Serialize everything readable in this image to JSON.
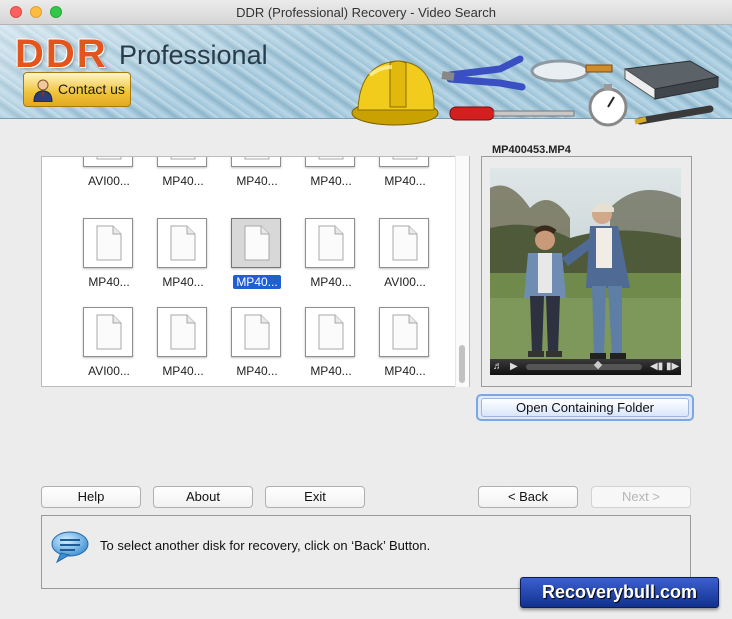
{
  "window": {
    "title": "DDR (Professional) Recovery - Video Search"
  },
  "banner": {
    "logo_ddr": "DDR",
    "logo_professional": "Professional",
    "contact_label": "Contact us"
  },
  "files": [
    {
      "name": "AVI00..."
    },
    {
      "name": "MP40..."
    },
    {
      "name": "MP40..."
    },
    {
      "name": "MP40..."
    },
    {
      "name": "MP40..."
    },
    {
      "name": "MP40..."
    },
    {
      "name": "MP40..."
    },
    {
      "name": "MP40...",
      "selected": true
    },
    {
      "name": "MP40..."
    },
    {
      "name": "AVI00..."
    },
    {
      "name": "AVI00..."
    },
    {
      "name": "MP40..."
    },
    {
      "name": "MP40..."
    },
    {
      "name": "MP40..."
    },
    {
      "name": "MP40..."
    }
  ],
  "preview": {
    "label": "MP400453.MP4",
    "playback_position": 0.62
  },
  "open_folder_label": "Open Containing Folder",
  "buttons": {
    "help": "Help",
    "about": "About",
    "exit": "Exit",
    "back": "< Back",
    "next": "Next >"
  },
  "info": {
    "message": "To select another disk for recovery, click on ‘Back’ Button."
  },
  "brand": "Recoverybull.com",
  "colors": {
    "logo": "#e2551c",
    "selection": "#1e5fd4",
    "brand_bg": "#12328f"
  }
}
